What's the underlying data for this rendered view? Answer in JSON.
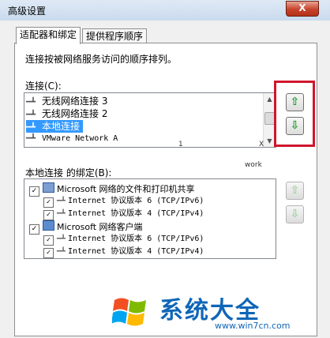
{
  "window": {
    "title": "高级设置",
    "close_label": "X"
  },
  "tabs": [
    {
      "label": "适配器和绑定",
      "active": true
    },
    {
      "label": "提供程序顺序",
      "active": false
    }
  ],
  "description": "连接按被网络服务访问的顺序排列。",
  "connections": {
    "label": "连接(C):",
    "items": [
      {
        "label": "无线网络连接 3",
        "selected": false
      },
      {
        "label": "无线网络连接 2",
        "selected": false
      },
      {
        "label": "本地连接",
        "selected": true
      },
      {
        "label": "VMware Network A",
        "selected": false
      }
    ],
    "up_icon": "up-arrow-icon",
    "down_icon": "down-arrow-icon",
    "ghost_text": [
      "1",
      "X",
      "work"
    ]
  },
  "bindings": {
    "label": "本地连接 的绑定(B):",
    "items": [
      {
        "label": "Microsoft 网络的文件和打印机共享",
        "checked": true,
        "level": 0,
        "icon": "printer-share-icon"
      },
      {
        "label": "Internet 协议版本 6 (TCP/IPv6)",
        "checked": true,
        "level": 1,
        "icon": "protocol-icon"
      },
      {
        "label": "Internet 协议版本 4 (TCP/IPv4)",
        "checked": true,
        "level": 1,
        "icon": "protocol-icon"
      },
      {
        "label": "Microsoft 网络客户端",
        "checked": true,
        "level": 0,
        "icon": "network-client-icon"
      },
      {
        "label": "Internet 协议版本 6 (TCP/IPv6)",
        "checked": true,
        "level": 1,
        "icon": "protocol-icon"
      },
      {
        "label": "Internet 协议版本 4 (TCP/IPv4)",
        "checked": true,
        "level": 1,
        "icon": "protocol-icon"
      }
    ]
  },
  "watermark": {
    "title": "系统大全",
    "url": "www.win7cn.com"
  },
  "colors": {
    "selection": "#3399ff",
    "highlight_box": "#d0162e",
    "arrow_green": "#1f9c2a",
    "watermark_blue": "#0f66b8"
  }
}
